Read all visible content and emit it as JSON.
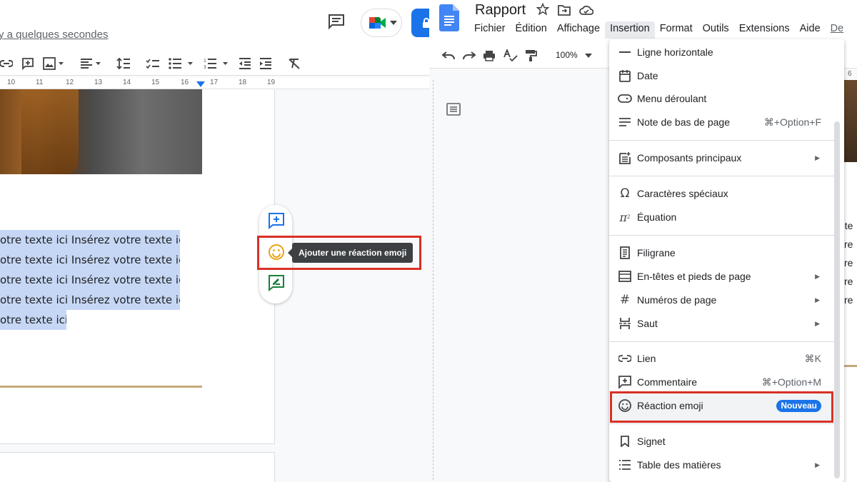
{
  "left": {
    "saved_status": "y a quelques secondes",
    "ruler_ticks": [
      "10",
      "11",
      "12",
      "13",
      "14",
      "15",
      "16",
      "17",
      "18",
      "19"
    ],
    "selected_lines": [
      "otre texte ici Insérez votre texte ici",
      "otre texte ici Insérez votre texte ici",
      "otre texte ici Insérez votre texte ici",
      "otre texte ici Insérez votre texte ici",
      "otre texte ici."
    ],
    "tooltip": "Ajouter une réaction emoji"
  },
  "right": {
    "doc_title": "Rapport",
    "menus": [
      "Fichier",
      "Édition",
      "Affichage",
      "Insertion",
      "Format",
      "Outils",
      "Extensions",
      "Aide",
      "De"
    ],
    "zoom": "100%",
    "ruler_edge": "6",
    "edge_text": [
      "ote",
      "re",
      "re",
      "re",
      "re"
    ],
    "insert_menu": {
      "ligne": "Ligne horizontale",
      "date": "Date",
      "dropdown": "Menu déroulant",
      "footnote": "Note de bas de page",
      "footnote_sc": "⌘+Option+F",
      "components": "Composants principaux",
      "special_chars": "Caractères spéciaux",
      "equation": "Équation",
      "watermark": "Filigrane",
      "headers": "En-têtes et pieds de page",
      "page_numbers": "Numéros de page",
      "break": "Saut",
      "link": "Lien",
      "link_sc": "⌘K",
      "comment": "Commentaire",
      "comment_sc": "⌘+Option+M",
      "emoji": "Réaction emoji",
      "emoji_badge": "Nouveau",
      "bookmark": "Signet",
      "toc": "Table des matières"
    }
  },
  "colors": {
    "accent": "#1a73e8",
    "highlight_border": "#d93025",
    "selection": "#c6d7f5",
    "tooltip_bg": "#3c4043"
  }
}
